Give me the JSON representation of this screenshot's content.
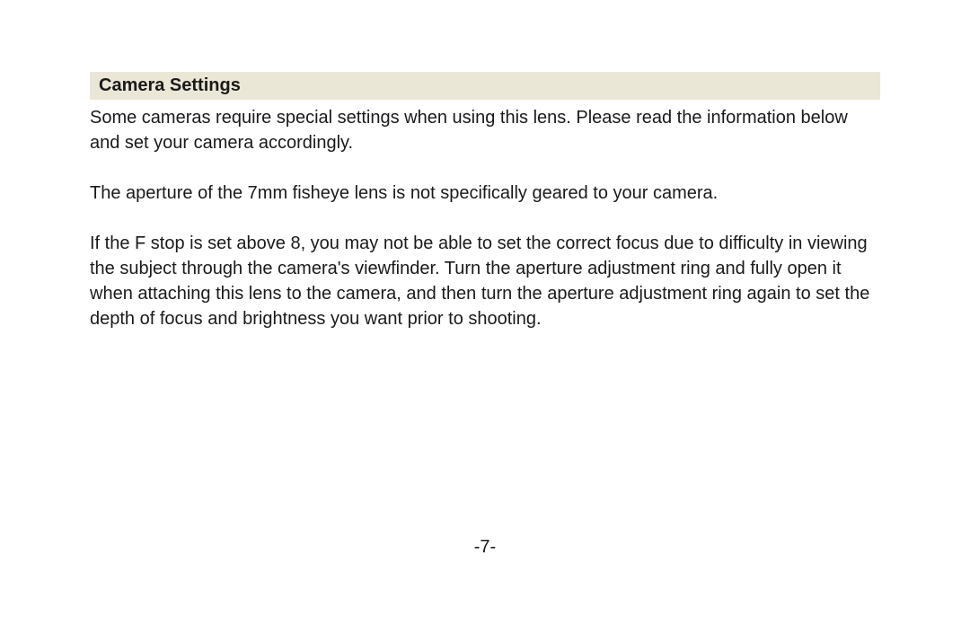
{
  "section": {
    "title": "Camera Settings"
  },
  "paragraphs": {
    "p1": "Some cameras require special settings when using this lens.  Please read the information below and set your camera accordingly.",
    "p2": "The aperture of the 7mm fisheye lens is not specifically geared to your camera.",
    "p3": "If the F stop is set above 8,  you may not be able to set the correct focus due to difficulty in viewing the subject through the camera's viewfinder. Turn the aperture adjustment ring and fully open it when attaching this lens to the camera, and then turn the aperture adjustment ring again to set the depth of focus and brightness you want prior to shooting."
  },
  "page_number": "-7-"
}
